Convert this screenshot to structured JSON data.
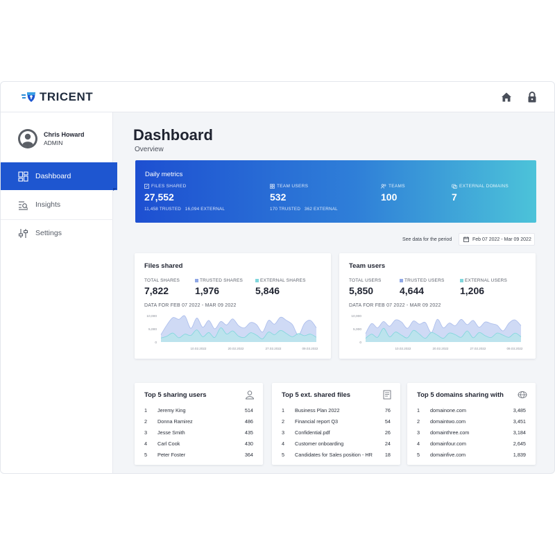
{
  "brand": {
    "name": "TRICENT"
  },
  "topbar": {
    "icons": [
      "home-icon",
      "lock-icon"
    ]
  },
  "user": {
    "name": "Chris Howard",
    "role": "ADMIN"
  },
  "nav": [
    {
      "label": "Dashboard",
      "icon": "dashboard-icon",
      "active": true
    },
    {
      "label": "Insights",
      "icon": "insights-icon",
      "active": false
    },
    {
      "label": "Settings",
      "icon": "settings-icon",
      "active": false
    }
  ],
  "page": {
    "title": "Dashboard",
    "subtitle": "Overview"
  },
  "metrics": {
    "title": "Daily metrics",
    "items": [
      {
        "label": "FILES SHARED",
        "value": "27,552",
        "sub": "11,458 TRUSTED   16,094 EXTERNAL"
      },
      {
        "label": "TEAM USERS",
        "value": "532",
        "sub": "170 TRUSTED   362 EXTERNAL"
      },
      {
        "label": "TEAMS",
        "value": "100",
        "sub": ""
      },
      {
        "label": "EXTERNAL DOMAINS",
        "value": "7",
        "sub": ""
      }
    ]
  },
  "period": {
    "label": "See data for the period",
    "range": "Feb 07 2022 - Mar 09 2022"
  },
  "files_card": {
    "title": "Files shared",
    "stats": [
      {
        "label": "TOTAL SHARES",
        "value": "7,822"
      },
      {
        "label": "TRUSTED SHARES",
        "value": "1,976"
      },
      {
        "label": "EXTERNAL SHARES",
        "value": "5,846"
      }
    ],
    "data_for": "DATA FOR FEB 07 2022 - MAR 09 2022"
  },
  "users_card": {
    "title": "Team users",
    "stats": [
      {
        "label": "TOTAL USERS",
        "value": "5,850"
      },
      {
        "label": "TRUSTED USERS",
        "value": "4,644"
      },
      {
        "label": "EXTERNAL USERS",
        "value": "1,206"
      }
    ],
    "data_for": "DATA FOR FEB 07 2022 - MAR 09 2022"
  },
  "colors": {
    "accent": "#1e56d0",
    "trusted": "#8fa7e6",
    "external": "#7fd6dc"
  },
  "chart_data": [
    {
      "type": "area",
      "ylim": [
        0,
        10000
      ],
      "yticks": [
        "10,000",
        "5,000",
        "0"
      ],
      "xticks": [
        "10.02.2022",
        "20.02.2022",
        "27.02.2022",
        "09.03.2022"
      ],
      "series": [
        {
          "name": "TRUSTED SHARES",
          "values": [
            2800,
            6500,
            9300,
            8600,
            9900,
            5200,
            9100,
            5600,
            8200,
            5000,
            7800,
            6500,
            8800,
            6200,
            5400,
            7400,
            6600,
            3800,
            8200,
            6800,
            9400,
            8200,
            6600,
            2600,
            7000,
            8200,
            5400
          ]
        },
        {
          "name": "EXTERNAL SHARES",
          "values": [
            1500,
            2200,
            3400,
            1600,
            3000,
            2500,
            4600,
            2000,
            3600,
            1700,
            5400,
            3000,
            4200,
            2200,
            1800,
            3500,
            2600,
            1200,
            3800,
            2800,
            4400,
            3200,
            2000,
            3200,
            2400,
            3000,
            1800
          ]
        }
      ]
    },
    {
      "type": "area",
      "ylim": [
        0,
        10000
      ],
      "yticks": [
        "10,000",
        "5,000",
        "0"
      ],
      "xticks": [
        "10.02.2022",
        "20.02.2022",
        "27.02.2022",
        "09.03.2022"
      ],
      "series": [
        {
          "name": "TRUSTED USERS",
          "values": [
            3200,
            7000,
            5400,
            7800,
            6000,
            8400,
            7600,
            5200,
            8000,
            6800,
            7400,
            3600,
            8600,
            5400,
            7200,
            6200,
            8600,
            6600,
            8200,
            5600,
            7600,
            7000,
            6400,
            4200,
            7200,
            8400,
            6200
          ]
        },
        {
          "name": "EXTERNAL USERS",
          "values": [
            1400,
            3000,
            1800,
            5200,
            2000,
            3800,
            2600,
            1600,
            4400,
            3000,
            1400,
            3600,
            2600,
            1400,
            3400,
            2800,
            1800,
            4200,
            1600,
            3600,
            2400,
            1700,
            3400,
            2600,
            1800,
            3400,
            2000
          ]
        }
      ]
    }
  ],
  "lists": [
    {
      "title": "Top 5 sharing users",
      "icon": "user-icon",
      "rows": [
        {
          "idx": "1",
          "name": "Jeremy King",
          "value": "514"
        },
        {
          "idx": "2",
          "name": "Donna Ramirez",
          "value": "486"
        },
        {
          "idx": "3",
          "name": "Jesse Smith",
          "value": "435"
        },
        {
          "idx": "4",
          "name": "Carl Cook",
          "value": "430"
        },
        {
          "idx": "5",
          "name": "Peter Foster",
          "value": "364"
        }
      ]
    },
    {
      "title": "Top 5 ext. shared files",
      "icon": "document-icon",
      "rows": [
        {
          "idx": "1",
          "name": "Business Plan 2022",
          "value": "76"
        },
        {
          "idx": "2",
          "name": "Financial report Q3",
          "value": "54"
        },
        {
          "idx": "3",
          "name": "Confidential.pdf",
          "value": "26"
        },
        {
          "idx": "4",
          "name": "Customer onboarding",
          "value": "24"
        },
        {
          "idx": "5",
          "name": "Candidates for Sales position - HR",
          "value": "18"
        }
      ]
    },
    {
      "title": "Top 5 domains sharing with",
      "icon": "globe-icon",
      "rows": [
        {
          "idx": "1",
          "name": "domainone.com",
          "value": "3,485"
        },
        {
          "idx": "2",
          "name": "domaintwo.com",
          "value": "3,451"
        },
        {
          "idx": "3",
          "name": "domainthree.com",
          "value": "3,184"
        },
        {
          "idx": "4",
          "name": "domainfour.com",
          "value": "2,645"
        },
        {
          "idx": "5",
          "name": "domainfive.com",
          "value": "1,839"
        }
      ]
    }
  ]
}
